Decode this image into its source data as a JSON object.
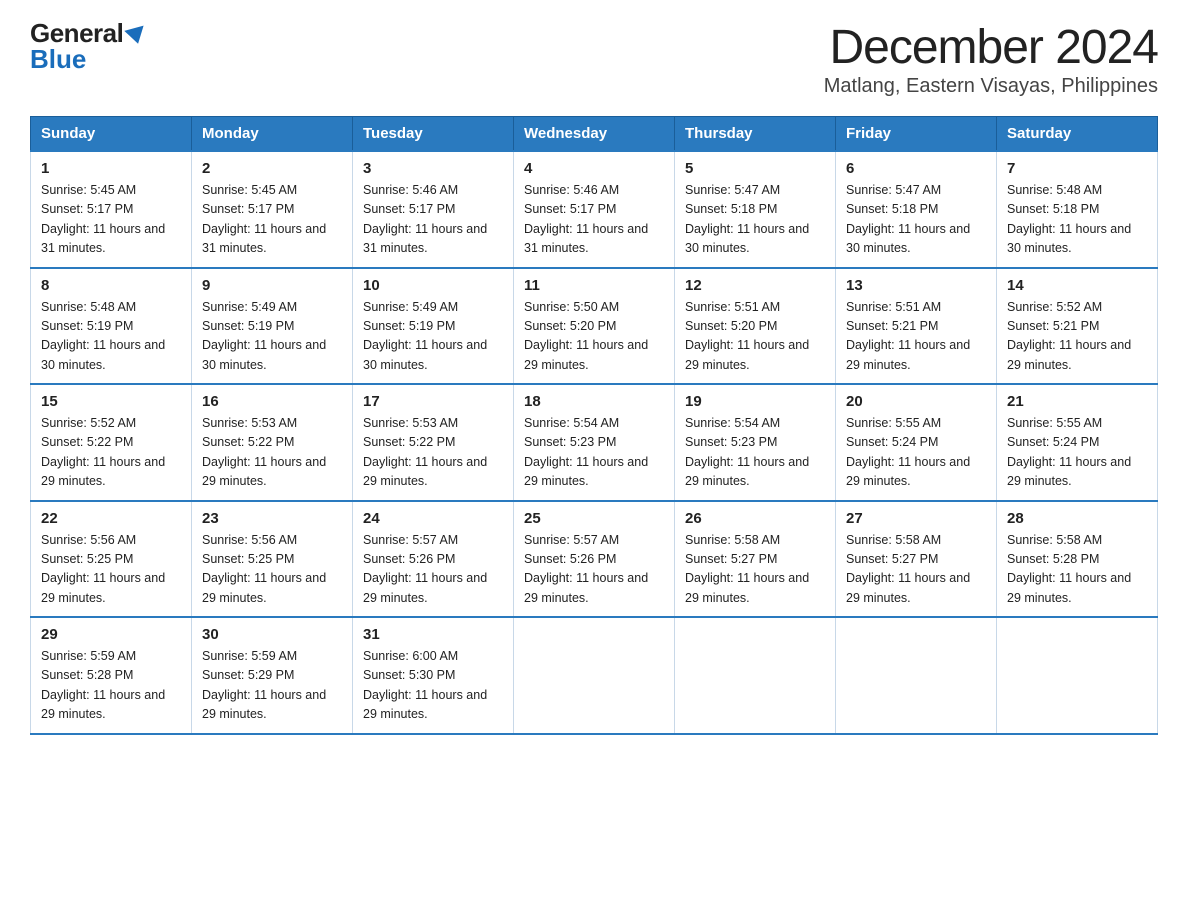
{
  "logo": {
    "general": "General",
    "blue": "Blue"
  },
  "title": "December 2024",
  "subtitle": "Matlang, Eastern Visayas, Philippines",
  "header_days": [
    "Sunday",
    "Monday",
    "Tuesday",
    "Wednesday",
    "Thursday",
    "Friday",
    "Saturday"
  ],
  "weeks": [
    [
      {
        "day": "1",
        "sunrise": "5:45 AM",
        "sunset": "5:17 PM",
        "daylight": "11 hours and 31 minutes."
      },
      {
        "day": "2",
        "sunrise": "5:45 AM",
        "sunset": "5:17 PM",
        "daylight": "11 hours and 31 minutes."
      },
      {
        "day": "3",
        "sunrise": "5:46 AM",
        "sunset": "5:17 PM",
        "daylight": "11 hours and 31 minutes."
      },
      {
        "day": "4",
        "sunrise": "5:46 AM",
        "sunset": "5:17 PM",
        "daylight": "11 hours and 31 minutes."
      },
      {
        "day": "5",
        "sunrise": "5:47 AM",
        "sunset": "5:18 PM",
        "daylight": "11 hours and 30 minutes."
      },
      {
        "day": "6",
        "sunrise": "5:47 AM",
        "sunset": "5:18 PM",
        "daylight": "11 hours and 30 minutes."
      },
      {
        "day": "7",
        "sunrise": "5:48 AM",
        "sunset": "5:18 PM",
        "daylight": "11 hours and 30 minutes."
      }
    ],
    [
      {
        "day": "8",
        "sunrise": "5:48 AM",
        "sunset": "5:19 PM",
        "daylight": "11 hours and 30 minutes."
      },
      {
        "day": "9",
        "sunrise": "5:49 AM",
        "sunset": "5:19 PM",
        "daylight": "11 hours and 30 minutes."
      },
      {
        "day": "10",
        "sunrise": "5:49 AM",
        "sunset": "5:19 PM",
        "daylight": "11 hours and 30 minutes."
      },
      {
        "day": "11",
        "sunrise": "5:50 AM",
        "sunset": "5:20 PM",
        "daylight": "11 hours and 29 minutes."
      },
      {
        "day": "12",
        "sunrise": "5:51 AM",
        "sunset": "5:20 PM",
        "daylight": "11 hours and 29 minutes."
      },
      {
        "day": "13",
        "sunrise": "5:51 AM",
        "sunset": "5:21 PM",
        "daylight": "11 hours and 29 minutes."
      },
      {
        "day": "14",
        "sunrise": "5:52 AM",
        "sunset": "5:21 PM",
        "daylight": "11 hours and 29 minutes."
      }
    ],
    [
      {
        "day": "15",
        "sunrise": "5:52 AM",
        "sunset": "5:22 PM",
        "daylight": "11 hours and 29 minutes."
      },
      {
        "day": "16",
        "sunrise": "5:53 AM",
        "sunset": "5:22 PM",
        "daylight": "11 hours and 29 minutes."
      },
      {
        "day": "17",
        "sunrise": "5:53 AM",
        "sunset": "5:22 PM",
        "daylight": "11 hours and 29 minutes."
      },
      {
        "day": "18",
        "sunrise": "5:54 AM",
        "sunset": "5:23 PM",
        "daylight": "11 hours and 29 minutes."
      },
      {
        "day": "19",
        "sunrise": "5:54 AM",
        "sunset": "5:23 PM",
        "daylight": "11 hours and 29 minutes."
      },
      {
        "day": "20",
        "sunrise": "5:55 AM",
        "sunset": "5:24 PM",
        "daylight": "11 hours and 29 minutes."
      },
      {
        "day": "21",
        "sunrise": "5:55 AM",
        "sunset": "5:24 PM",
        "daylight": "11 hours and 29 minutes."
      }
    ],
    [
      {
        "day": "22",
        "sunrise": "5:56 AM",
        "sunset": "5:25 PM",
        "daylight": "11 hours and 29 minutes."
      },
      {
        "day": "23",
        "sunrise": "5:56 AM",
        "sunset": "5:25 PM",
        "daylight": "11 hours and 29 minutes."
      },
      {
        "day": "24",
        "sunrise": "5:57 AM",
        "sunset": "5:26 PM",
        "daylight": "11 hours and 29 minutes."
      },
      {
        "day": "25",
        "sunrise": "5:57 AM",
        "sunset": "5:26 PM",
        "daylight": "11 hours and 29 minutes."
      },
      {
        "day": "26",
        "sunrise": "5:58 AM",
        "sunset": "5:27 PM",
        "daylight": "11 hours and 29 minutes."
      },
      {
        "day": "27",
        "sunrise": "5:58 AM",
        "sunset": "5:27 PM",
        "daylight": "11 hours and 29 minutes."
      },
      {
        "day": "28",
        "sunrise": "5:58 AM",
        "sunset": "5:28 PM",
        "daylight": "11 hours and 29 minutes."
      }
    ],
    [
      {
        "day": "29",
        "sunrise": "5:59 AM",
        "sunset": "5:28 PM",
        "daylight": "11 hours and 29 minutes."
      },
      {
        "day": "30",
        "sunrise": "5:59 AM",
        "sunset": "5:29 PM",
        "daylight": "11 hours and 29 minutes."
      },
      {
        "day": "31",
        "sunrise": "6:00 AM",
        "sunset": "5:30 PM",
        "daylight": "11 hours and 29 minutes."
      },
      null,
      null,
      null,
      null
    ]
  ]
}
